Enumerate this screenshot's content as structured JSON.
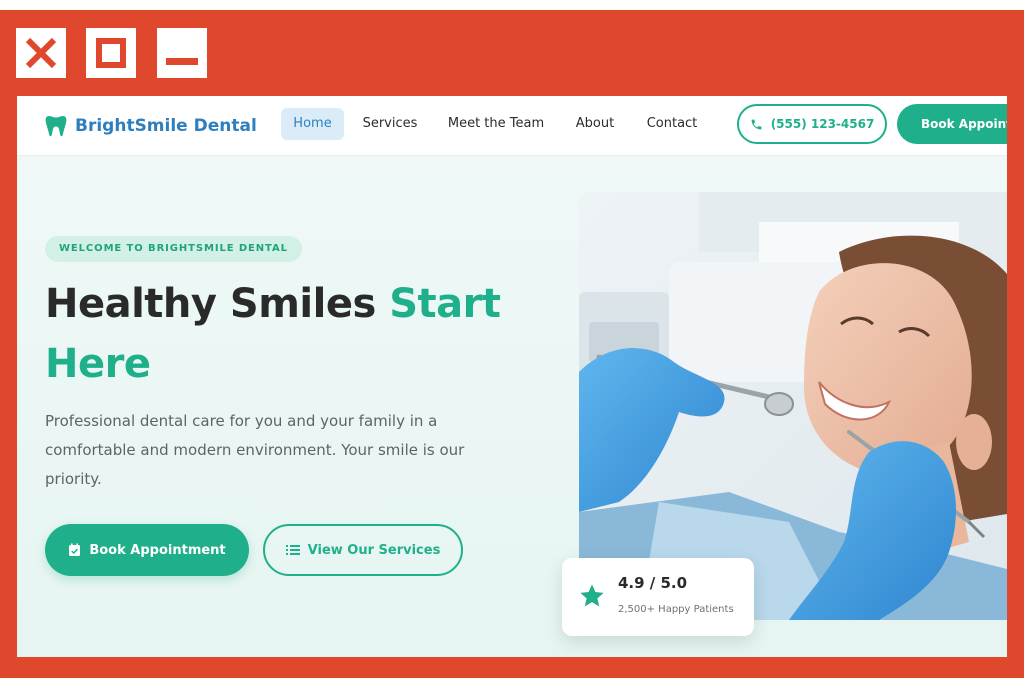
{
  "window_controls": {
    "close_icon": "close-icon",
    "maximize_icon": "maximize-icon",
    "minimize_icon": "minimize-icon"
  },
  "header": {
    "brand_name": "BrightSmile Dental",
    "brand_icon": "tooth-icon",
    "nav": [
      {
        "label": "Home",
        "active": true
      },
      {
        "label": "Services",
        "active": false
      },
      {
        "label": "Meet the Team",
        "active": false
      },
      {
        "label": "About",
        "active": false
      },
      {
        "label": "Contact",
        "active": false
      }
    ],
    "phone_label": "(555) 123-4567",
    "book_label": "Book Appointment"
  },
  "hero": {
    "eyebrow": "WELCOME TO BRIGHTSMILE DENTAL",
    "headline_part1": "Healthy Smiles ",
    "headline_accent1": "Start",
    "headline_accent2": "Here",
    "description": "Professional dental care for you and your family in a comfortable and modern environment. Your smile is our priority.",
    "cta_primary": "Book Appointment",
    "cta_primary_icon": "calendar-check-icon",
    "cta_secondary": "View Our Services",
    "cta_secondary_icon": "list-icon"
  },
  "rating": {
    "value": "4.9 / 5.0",
    "subtitle": "2,500+ Happy Patients",
    "icon": "star-icon"
  },
  "colors": {
    "frame": "#e0482e",
    "brand_blue": "#2f7fbf",
    "accent_green": "#1fb08b",
    "text_dark": "#2a2a2a",
    "text_muted": "#5d6468"
  }
}
